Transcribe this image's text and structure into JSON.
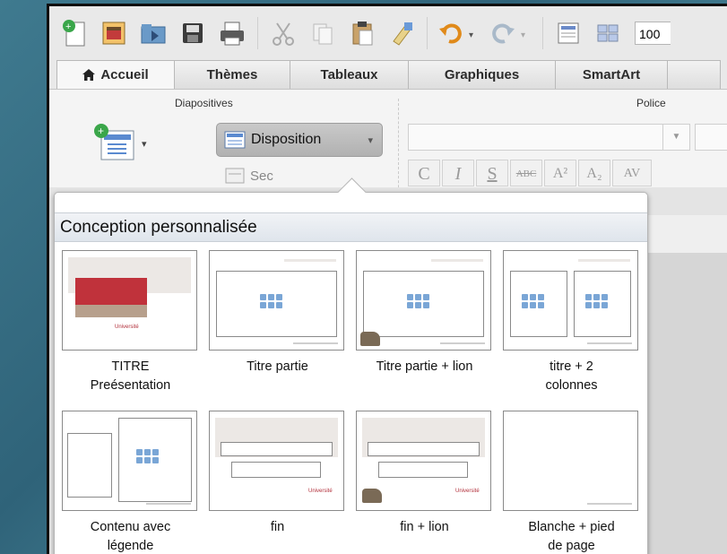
{
  "toolbar": {
    "icons": [
      "new-presentation-icon",
      "gallery-icon",
      "open-icon",
      "save-icon",
      "print-icon",
      "cut-icon",
      "copy-icon",
      "paste-icon",
      "format-painter-icon",
      "undo-icon",
      "redo-icon",
      "slide-view-icon",
      "sorter-view-icon"
    ],
    "zoom_value": "100"
  },
  "tabs": [
    {
      "label": "Accueil",
      "active": true
    },
    {
      "label": "Thèmes"
    },
    {
      "label": "Tableaux"
    },
    {
      "label": "Graphiques"
    },
    {
      "label": "SmartArt"
    }
  ],
  "ribbon": {
    "group_slides_label": "Diapositives",
    "group_font_label": "Police",
    "layout_button_label": "Disposition",
    "section_button_label": "Sec",
    "format_buttons": [
      "C",
      "I",
      "S",
      "ABC",
      "A²",
      "A₂",
      "AV"
    ]
  },
  "layout_popup": {
    "header": "Conception personnalisée",
    "layouts": [
      {
        "label_line1": "TITRE",
        "label_line2": "Preésentation"
      },
      {
        "label_line1": "Titre partie",
        "label_line2": ""
      },
      {
        "label_line1": "Titre partie + lion",
        "label_line2": ""
      },
      {
        "label_line1": "titre + 2",
        "label_line2": "colonnes"
      },
      {
        "label_line1": "Contenu avec",
        "label_line2": "légende"
      },
      {
        "label_line1": "fin",
        "label_line2": ""
      },
      {
        "label_line1": "fin + lion",
        "label_line2": ""
      },
      {
        "label_line1": "Blanche + pied",
        "label_line2": "de page"
      }
    ],
    "logo_text": "Université"
  },
  "colors": {
    "brand_red": "#c0323b",
    "tan": "#b7a08c",
    "icon_blue": "#7aa6d6"
  }
}
